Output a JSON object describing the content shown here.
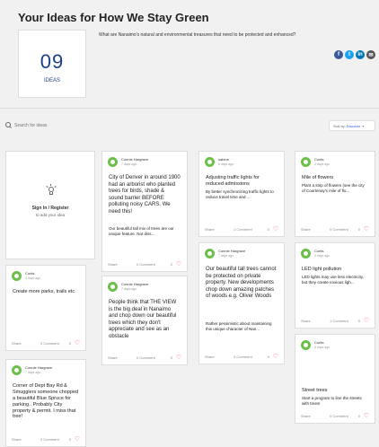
{
  "header": {
    "title": "Your Ideas for How We Stay Green",
    "question": "What are Nanaimo's natural and environmental treasures that need to be protected and enhanced?"
  },
  "counter": {
    "value": "09",
    "label": "IDEAS"
  },
  "social": {
    "items": [
      {
        "name": "facebook-icon",
        "glyph": "f",
        "color": "#3b5998"
      },
      {
        "name": "twitter-icon",
        "glyph": "t",
        "color": "#1da1f2"
      },
      {
        "name": "linkedin-icon",
        "glyph": "in",
        "color": "#0077b5"
      },
      {
        "name": "email-icon",
        "glyph": "✉",
        "color": "#555555"
      }
    ]
  },
  "search": {
    "placeholder": "Search for ideas"
  },
  "sort": {
    "label": "Sort by:",
    "value": "Discover"
  },
  "signin": {
    "title": "Sign In / Register",
    "subtitle": "to add your idea"
  },
  "footer_labels": {
    "share": "Share"
  },
  "cards": {
    "c1": {
      "author": "Connie Hargrave",
      "time": "7 days ago",
      "title": "City of Denver in around 1900 had an arborist who planted trees for birds, shade & sound barrier BEFORE polluting noisy CARS. We need this!",
      "desc": "Our beautiful tall mix of trees are our unique feature. Not diss...",
      "comments": "0 Comment",
      "likes": "2"
    },
    "c2": {
      "author": "sabine",
      "time": "6 days ago",
      "title": "Adjusting traffic lights for reduced admissions",
      "desc": "By better synchronizing traffic lights to reduce travel time and ...",
      "comments": "1 Comment",
      "likes": "0"
    },
    "c3": {
      "author": "Curtis",
      "time": "4 days ago",
      "title": "Mile of flowers",
      "desc": "Plant a strip of flowers (see the city of Courtenay's mile of flo...",
      "comments": "0 Comment",
      "likes": "0"
    },
    "c4": {
      "author": "Curtis",
      "time": "4 days ago",
      "title": "Create more parks, trails etc.",
      "comments": "0 Comment",
      "likes": "0"
    },
    "c5": {
      "author": "Connie Hargrave",
      "time": "7 days ago",
      "title": "People think that THE VIEW is the big deal in Nanaimo and chop down our beautiful trees which they don't appreciate and see as an obstacle",
      "comments": "0 Comment",
      "likes": "0"
    },
    "c6": {
      "author": "Connie Hargrave",
      "time": "7 days ago",
      "title": "Our beautiful tall trees cannot be protected on private property. New developments chop down amazing patches of woods e.g. Oliver Woods",
      "desc": "Rather pessimistic about maintaining this unique character of Nan...",
      "comments": "0 Comment",
      "likes": "0"
    },
    "c7": {
      "author": "Curtis",
      "time": "4 days ago",
      "title": "LED light pollution",
      "desc": "LED lights may use less electricity, but they create noxious ligh...",
      "comments": "1 Comment",
      "likes": "0"
    },
    "c8": {
      "author": "Connie Hargrave",
      "time": "7 days ago",
      "title": "Corner of Dept Bay Rd & Smugglers someone chopped a beautiful Blue Spruce for parking.. Probably City property & permit. I miss that tree!",
      "comments": "0 Comment",
      "likes": "0"
    },
    "c9": {
      "author": "Curtis",
      "time": "4 days ago",
      "title": "Street trees",
      "desc": "Start a program to line the streets with trees!",
      "comments": "0 Comment",
      "likes": "0"
    }
  }
}
